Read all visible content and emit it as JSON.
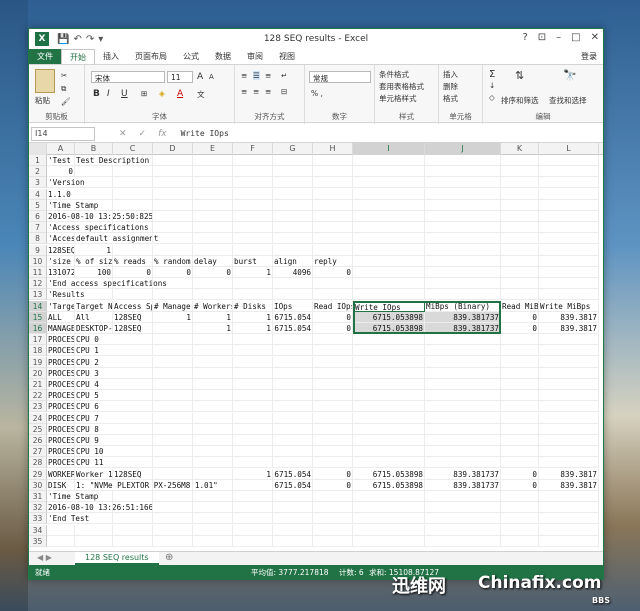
{
  "window": {
    "title": "128 SEQ results - Excel",
    "qat": [
      "💾",
      "↶",
      "↷",
      "▾"
    ],
    "buttons": [
      "?",
      "⊡",
      "–",
      "□",
      "✕"
    ]
  },
  "tabs": [
    "文件",
    "开始",
    "插入",
    "页面布局",
    "公式",
    "数据",
    "审阅",
    "视图"
  ],
  "login": "登录",
  "ribbon": {
    "paste": "粘贴",
    "clipboard": "剪贴板",
    "font_name": "宋体",
    "font_size": "11",
    "font_group": "字体",
    "align_group": "对齐方式",
    "number_format": "常规",
    "percent": "% ,",
    "number_group": "数字",
    "cond_format": "条件格式",
    "table_format": "套用表格格式",
    "cell_style": "单元格样式",
    "style_group": "样式",
    "insert": "插入",
    "delete": "删除",
    "format": "格式",
    "cells_group": "单元格",
    "sort_filter": "排序和筛选",
    "find_select": "查找和选择",
    "edit_group": "编辑",
    "bold": "B",
    "italic": "I",
    "underline": "U",
    "grow": "A",
    "shrink": "A",
    "font_color_label": "A",
    "wen": "文"
  },
  "formula_bar": {
    "name_box": "I14",
    "cancel": "✕",
    "enter": "✓",
    "fx": "fx",
    "content": "Write IOps"
  },
  "columns": [
    "A",
    "B",
    "C",
    "D",
    "E",
    "F",
    "G",
    "H",
    "I",
    "J",
    "K",
    "L"
  ],
  "rows": [
    {
      "n": "1",
      "cells": [
        "'Test Typ",
        "Test Description",
        "",
        "",
        "",
        "",
        "",
        "",
        "",
        "",
        "",
        ""
      ]
    },
    {
      "n": "2",
      "cells": [
        "0",
        "",
        "",
        "",
        "",
        "",
        "",
        "",
        "",
        "",
        "",
        ""
      ]
    },
    {
      "n": "3",
      "cells": [
        "'Version",
        "",
        "",
        "",
        "",
        "",
        "",
        "",
        "",
        "",
        "",
        ""
      ]
    },
    {
      "n": "4",
      "cells": [
        "1.1.0",
        "",
        "",
        "",
        "",
        "",
        "",
        "",
        "",
        "",
        "",
        ""
      ]
    },
    {
      "n": "5",
      "cells": [
        "'Time Stamp",
        "",
        "",
        "",
        "",
        "",
        "",
        "",
        "",
        "",
        "",
        ""
      ]
    },
    {
      "n": "6",
      "cells": [
        "2016-08-10 13:25:50:825",
        "",
        "",
        "",
        "",
        "",
        "",
        "",
        "",
        "",
        "",
        ""
      ]
    },
    {
      "n": "7",
      "cells": [
        "'Access specifications",
        "",
        "",
        "",
        "",
        "",
        "",
        "",
        "",
        "",
        "",
        ""
      ]
    },
    {
      "n": "8",
      "cells": [
        "'Access",
        "default assignment",
        "",
        "",
        "",
        "",
        "",
        "",
        "",
        "",
        "",
        ""
      ]
    },
    {
      "n": "9",
      "cells": [
        "128SEQ",
        "1",
        "",
        "",
        "",
        "",
        "",
        "",
        "",
        "",
        "",
        ""
      ]
    },
    {
      "n": "10",
      "cells": [
        "'size",
        "% of size",
        "% reads",
        "% random",
        "delay",
        "burst",
        "align",
        "reply",
        "",
        "",
        "",
        ""
      ]
    },
    {
      "n": "11",
      "cells": [
        "131072",
        "100",
        "0",
        "0",
        "0",
        "1",
        "4096",
        "0",
        "",
        "",
        "",
        ""
      ]
    },
    {
      "n": "12",
      "cells": [
        "'End access specifications",
        "",
        "",
        "",
        "",
        "",
        "",
        "",
        "",
        "",
        "",
        ""
      ]
    },
    {
      "n": "13",
      "cells": [
        "'Results",
        "",
        "",
        "",
        "",
        "",
        "",
        "",
        "",
        "",
        "",
        ""
      ]
    },
    {
      "n": "14",
      "cells": [
        "'Target",
        "Target N",
        "Access Sp",
        "# Manager",
        "# Workers",
        "# Disks",
        "IOps",
        "Read IOps",
        "Write IOps",
        "MiBps (Binary)",
        "Read MiBps",
        "Write MiBps"
      ]
    },
    {
      "n": "15",
      "cells": [
        "ALL",
        "All",
        "128SEQ",
        "1",
        "1",
        "1",
        "6715.054",
        "0",
        "6715.053898",
        "839.381737",
        "0",
        "839.3817"
      ]
    },
    {
      "n": "16",
      "cells": [
        "MANAGER",
        "DESKTOP-",
        "128SEQ",
        "",
        "1",
        "1",
        "6715.054",
        "0",
        "6715.053898",
        "839.381737",
        "0",
        "839.3817"
      ]
    },
    {
      "n": "17",
      "cells": [
        "PROCESSOR",
        "CPU 0",
        "",
        "",
        "",
        "",
        "",
        "",
        "",
        "",
        "",
        ""
      ]
    },
    {
      "n": "18",
      "cells": [
        "PROCESSOR",
        "CPU 1",
        "",
        "",
        "",
        "",
        "",
        "",
        "",
        "",
        "",
        ""
      ]
    },
    {
      "n": "19",
      "cells": [
        "PROCESSOR",
        "CPU 2",
        "",
        "",
        "",
        "",
        "",
        "",
        "",
        "",
        "",
        ""
      ]
    },
    {
      "n": "20",
      "cells": [
        "PROCESSOR",
        "CPU 3",
        "",
        "",
        "",
        "",
        "",
        "",
        "",
        "",
        "",
        ""
      ]
    },
    {
      "n": "21",
      "cells": [
        "PROCESSOR",
        "CPU 4",
        "",
        "",
        "",
        "",
        "",
        "",
        "",
        "",
        "",
        ""
      ]
    },
    {
      "n": "22",
      "cells": [
        "PROCESSOR",
        "CPU 5",
        "",
        "",
        "",
        "",
        "",
        "",
        "",
        "",
        "",
        ""
      ]
    },
    {
      "n": "23",
      "cells": [
        "PROCESSOR",
        "CPU 6",
        "",
        "",
        "",
        "",
        "",
        "",
        "",
        "",
        "",
        ""
      ]
    },
    {
      "n": "24",
      "cells": [
        "PROCESSOR",
        "CPU 7",
        "",
        "",
        "",
        "",
        "",
        "",
        "",
        "",
        "",
        ""
      ]
    },
    {
      "n": "25",
      "cells": [
        "PROCESSOR",
        "CPU 8",
        "",
        "",
        "",
        "",
        "",
        "",
        "",
        "",
        "",
        ""
      ]
    },
    {
      "n": "26",
      "cells": [
        "PROCESSOR",
        "CPU 9",
        "",
        "",
        "",
        "",
        "",
        "",
        "",
        "",
        "",
        ""
      ]
    },
    {
      "n": "27",
      "cells": [
        "PROCESSOR",
        "CPU 10",
        "",
        "",
        "",
        "",
        "",
        "",
        "",
        "",
        "",
        ""
      ]
    },
    {
      "n": "28",
      "cells": [
        "PROCESSOR",
        "CPU 11",
        "",
        "",
        "",
        "",
        "",
        "",
        "",
        "",
        "",
        ""
      ]
    },
    {
      "n": "29",
      "cells": [
        "WORKER",
        "Worker 1",
        "128SEQ",
        "",
        "",
        "1",
        "6715.054",
        "0",
        "6715.053898",
        "839.381737",
        "0",
        "839.3817"
      ]
    },
    {
      "n": "30",
      "cells": [
        "DISK",
        "1: \"NVMe PLEXTOR PX-256M8 1.01\"",
        "",
        "",
        "",
        "",
        "6715.054",
        "0",
        "6715.053898",
        "839.381737",
        "0",
        "839.3817"
      ]
    },
    {
      "n": "31",
      "cells": [
        "'Time Stamp",
        "",
        "",
        "",
        "",
        "",
        "",
        "",
        "",
        "",
        "",
        ""
      ]
    },
    {
      "n": "32",
      "cells": [
        "2016-08-10 13:26:51:166",
        "",
        "",
        "",
        "",
        "",
        "",
        "",
        "",
        "",
        "",
        ""
      ]
    },
    {
      "n": "33",
      "cells": [
        "'End Test",
        "",
        "",
        "",
        "",
        "",
        "",
        "",
        "",
        "",
        "",
        ""
      ]
    },
    {
      "n": "34",
      "cells": [
        "",
        "",
        "",
        "",
        "",
        "",
        "",
        "",
        "",
        "",
        "",
        ""
      ]
    },
    {
      "n": "35",
      "cells": [
        "",
        "",
        "",
        "",
        "",
        "",
        "",
        "",
        "",
        "",
        "",
        ""
      ]
    }
  ],
  "sheet": {
    "name": "128 SEQ results",
    "add": "⊕",
    "nav": "◀ ▶"
  },
  "status": {
    "ready": "就绪",
    "average": "平均值: 3777.217818",
    "count": "计数: 6",
    "sum": "求和: 15108.87127"
  },
  "watermark": {
    "brand_cn": "迅维网",
    "brand_en": "Chinafix.com",
    "sub": "BBS"
  },
  "colors": {
    "excel_green": "#217346",
    "selection": "#d9d9d9"
  }
}
